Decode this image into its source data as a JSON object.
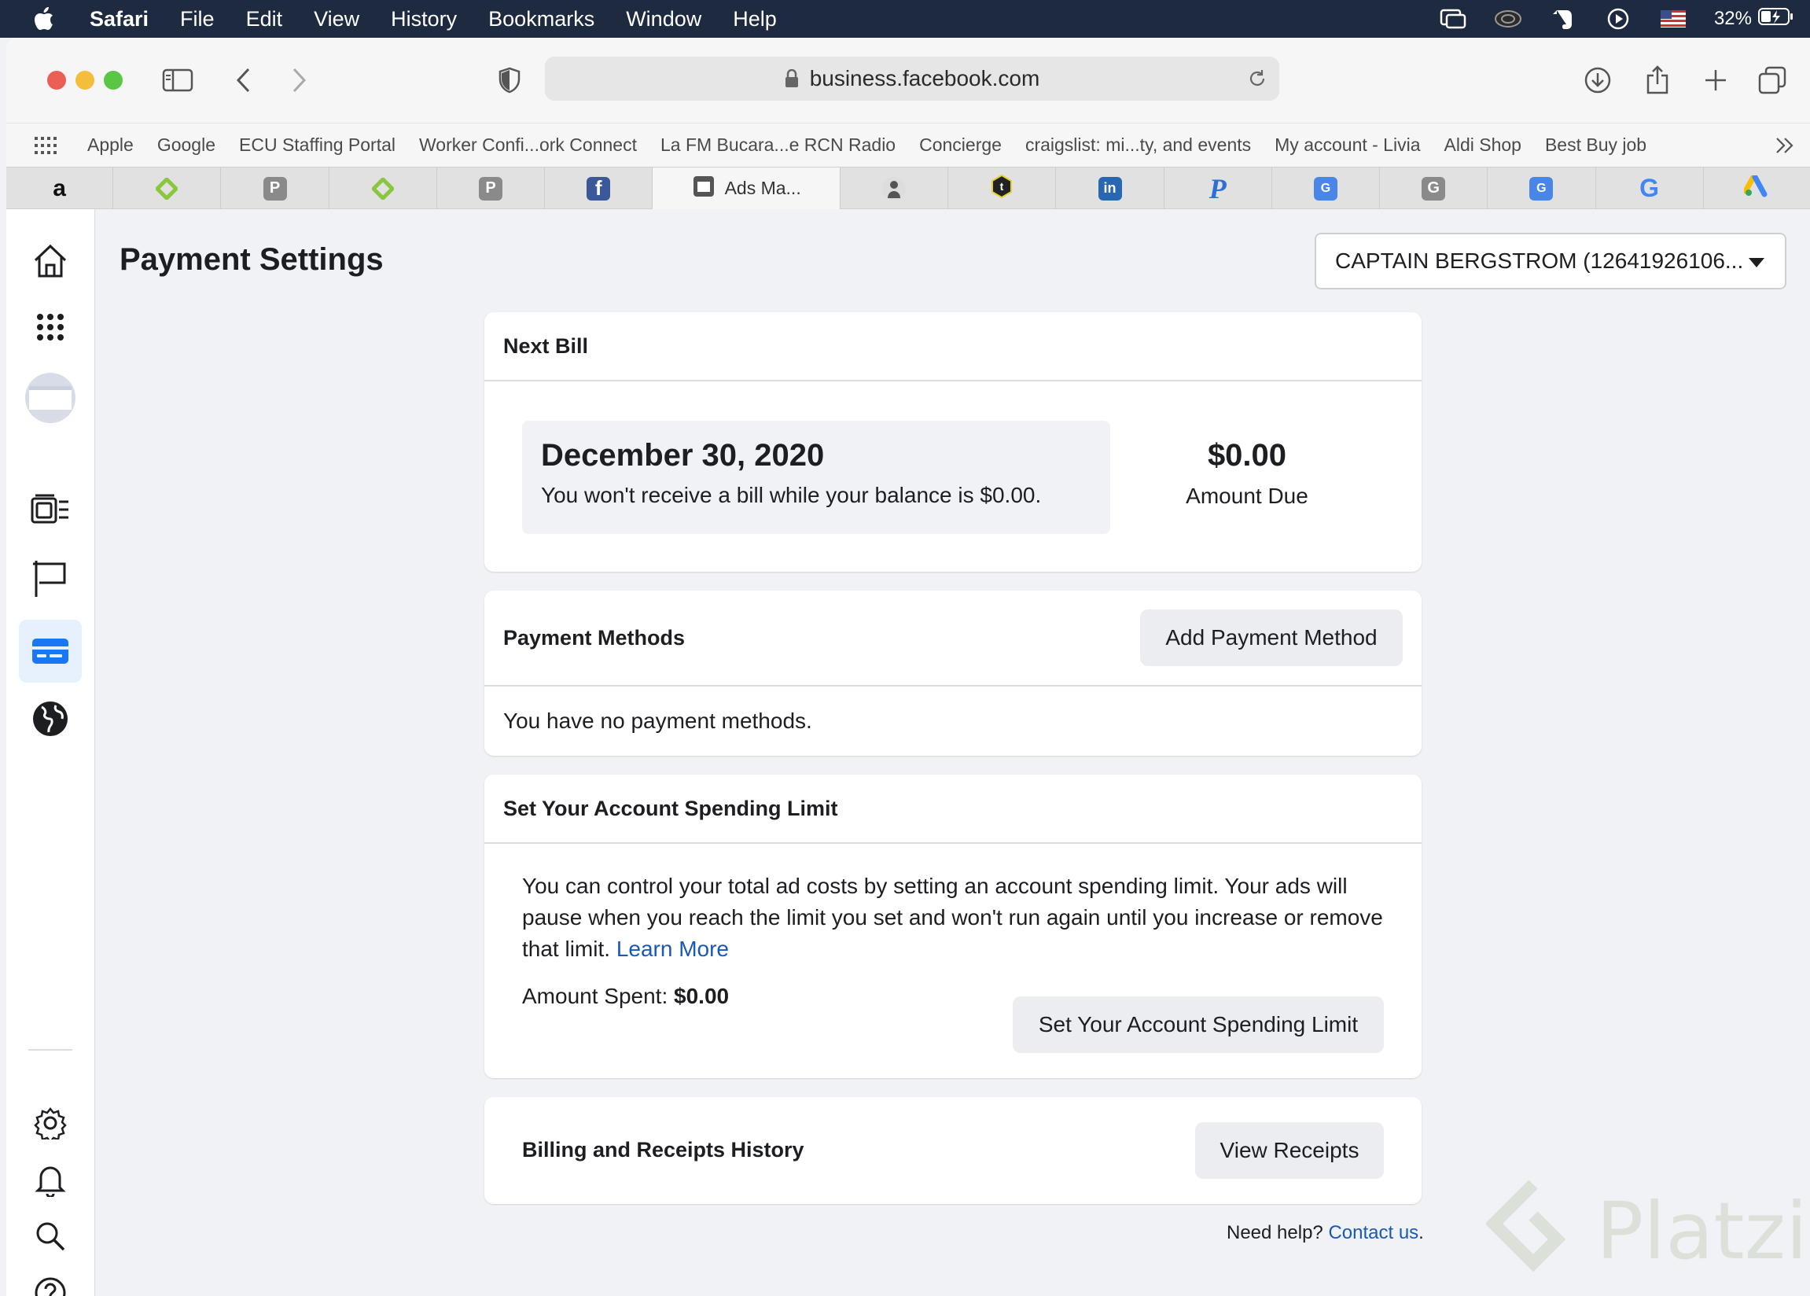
{
  "menubar": {
    "app": "Safari",
    "items": [
      "File",
      "Edit",
      "View",
      "History",
      "Bookmarks",
      "Window",
      "Help"
    ],
    "battery": "32%"
  },
  "browser": {
    "url": "business.facebook.com",
    "bookmarks": [
      "Apple",
      "Google",
      "ECU Staffing Portal",
      "Worker Confi...ork Connect",
      "La FM Bucara...e RCN Radio",
      "Concierge",
      "craigslist: mi...ty, and events",
      "My account - Livia",
      "Aldi Shop",
      "Best Buy job"
    ],
    "active_tab_title": "Ads Ma..."
  },
  "header": {
    "title": "Payment Settings",
    "account": "CAPTAIN BERGSTROM (12641926106..."
  },
  "next_bill": {
    "heading": "Next Bill",
    "date": "December 30, 2020",
    "note": "You won't receive a bill while your balance is $0.00.",
    "amount": "$0.00",
    "amount_label": "Amount Due"
  },
  "payment_methods": {
    "heading": "Payment Methods",
    "add_button": "Add Payment Method",
    "empty_text": "You have no payment methods."
  },
  "spending_limit": {
    "heading": "Set Your Account Spending Limit",
    "description": "You can control your total ad costs by setting an account spending limit. Your ads will pause when you reach the limit you set and won't run again until you increase or remove that limit.",
    "learn_more": "Learn More",
    "spent_label": "Amount Spent:",
    "spent_value": "$0.00",
    "button": "Set Your Account Spending Limit"
  },
  "billing": {
    "heading": "Billing and Receipts History",
    "button": "View Receipts"
  },
  "help": {
    "text": "Need help?",
    "link": "Contact us",
    "suffix": "."
  },
  "watermark": "Platzi",
  "colors": {
    "menubar": "#1d2a3f",
    "link": "#1a58b8",
    "active_nav": "#1877f2"
  }
}
